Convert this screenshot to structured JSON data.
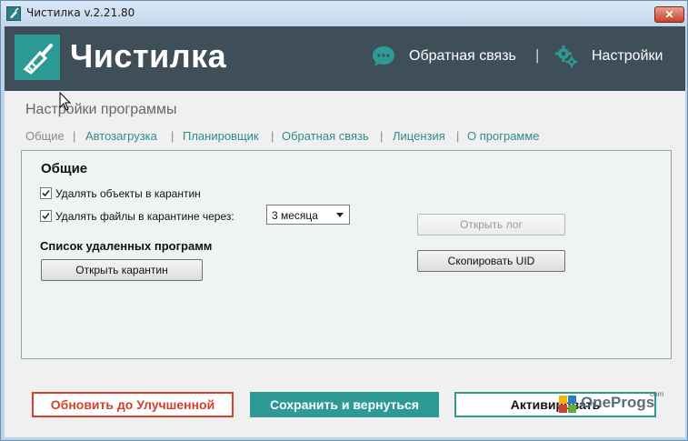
{
  "window": {
    "title": "Чистилка v.2.21.80",
    "close_label": "✕"
  },
  "header": {
    "logo_text": "Чистилка",
    "feedback_label": "Обратная связь",
    "separator": "|",
    "settings_label": "Настройки",
    "icons": [
      "broom-icon",
      "chat-bubble-icon",
      "gear-icon"
    ]
  },
  "page": {
    "title": "Настройки программы"
  },
  "tabs": [
    {
      "label": "Общие",
      "active": true
    },
    {
      "label": "Автозагрузка",
      "active": false
    },
    {
      "label": "Планировщик",
      "active": false
    },
    {
      "label": "Обратная связь",
      "active": false
    },
    {
      "label": "Лицензия",
      "active": false
    },
    {
      "label": "О программе",
      "active": false
    }
  ],
  "tab_separator": "|",
  "general": {
    "title": "Общие",
    "quarantine_checkbox": {
      "label": "Удалять объекты в карантин",
      "checked": true
    },
    "delete_files_checkbox": {
      "label": "Удалять файлы в карантине через:",
      "checked": true
    },
    "period_select": {
      "value": "3 месяца"
    },
    "removed_programs_title": "Список удаленных программ",
    "open_quarantine_button": "Открыть карантин",
    "open_log_button": "Открыть лог",
    "copy_uid_button": "Скопировать UID"
  },
  "footer": {
    "upgrade_button": "Обновить до Улучшенной",
    "save_button": "Сохранить и вернуться",
    "activate_button": "Активировать"
  },
  "watermark": {
    "text": "OneProgs",
    "suffix": "com"
  },
  "colors": {
    "accent": "#2e9a95",
    "header_bg": "#3f4f5a",
    "upgrade_red": "#d2412c",
    "tab_link": "#2d8c8c"
  }
}
